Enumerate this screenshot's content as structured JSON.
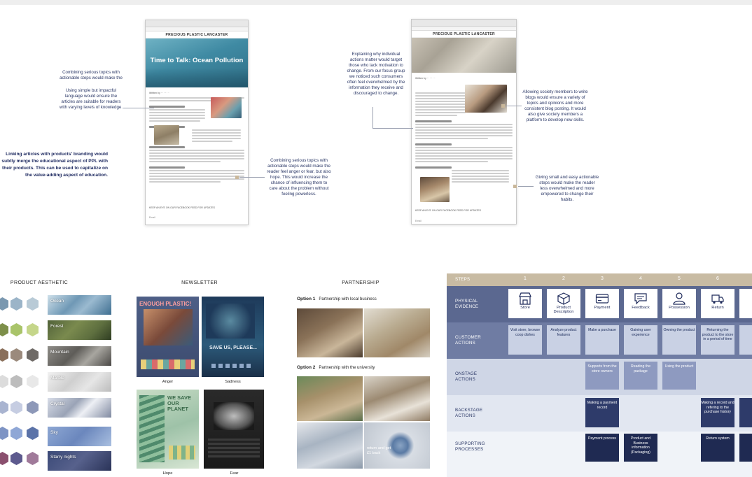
{
  "site": {
    "brand": "PRECIOUS PLASTIC LANCASTER",
    "hero_title": "Time to Talk: Ocean Pollution",
    "footer_text": "KEEP AN EYE ON OUR FACEBOOK FEED FOR UPDATES"
  },
  "annotations": {
    "combining_serious_topics": "Combining serious topics with actionable steps would make the",
    "simple_language": "Using simple but impactful language would ensure the articles are suitable for readers with varying levels of knowledge.",
    "linking_articles": "Linking articles with products' branding would subtly merge the educational aspect of PPL with their products. This can be used to capitalize on the value-adding aspect of education.",
    "hope_and_fear": "Combining serious topics with actionable steps would make the reader feel anger or fear, but also hope. This would increase the chance of influencing them to care about the problem without feeling powerless.",
    "explaining_actions": "Explaining why individual actions matter would target those who lack motivation to change. From our focus group we noticed such consumers often feel overwhelmed by the information they receive and discouraged to change.",
    "society_members": "Allowing society members to write blogs would ensure a variety of topics and opinions and more consistent blog posting. It would also give society members a platform to develop new skills.",
    "small_steps": "Giving small and easy actionable steps would make the reader less overwhelmed and more empowered to change their habits."
  },
  "product_aesthetic": {
    "title": "PRODUCT AESTHETIC",
    "swatches": [
      "Ocean",
      "Forest",
      "Mountain",
      "Marble",
      "Crystal",
      "Sky",
      "Starry nights"
    ]
  },
  "newsletter": {
    "title": "NEWSLETTER",
    "posters": [
      {
        "label": "Anger",
        "headline": "ENOUGH PLASTIC!"
      },
      {
        "label": "Sadness",
        "headline": "SAVE US, PLEASE..."
      },
      {
        "label": "Hope",
        "headline": "WE SAVE OUR PLANET"
      },
      {
        "label": "Fear",
        "headline": ""
      }
    ]
  },
  "partnership": {
    "title": "PARTNERSHIP",
    "option1": {
      "number": "Option 1",
      "text": "Partnership with local business"
    },
    "option2": {
      "number": "Option 2",
      "text": "Partnership with the university"
    },
    "photo_caption": "return and get £1 back"
  },
  "blueprint": {
    "header": "STEPS",
    "steps": [
      "1",
      "2",
      "3",
      "4",
      "5",
      "6"
    ],
    "rows": {
      "physical": "PHYSICAL EVIDENCE",
      "customer": "CUSTOMER ACTIONS",
      "onstage": "ONSTAGE ACTIONS",
      "backstage": "BACKSTAGE ACTIONS",
      "supporting": "SUPPORTING PROCESSES"
    },
    "evidence": [
      {
        "label": "Store",
        "icon": "store-icon"
      },
      {
        "label": "Product Description",
        "icon": "box-icon"
      },
      {
        "label": "Payment",
        "icon": "credit-card-icon"
      },
      {
        "label": "Feedback",
        "icon": "feedback-icon"
      },
      {
        "label": "Possession",
        "icon": "person-icon"
      },
      {
        "label": "Return",
        "icon": "return-truck-icon"
      }
    ],
    "customer_actions": [
      "Visit store, browse coop dishes",
      "Analyze product features",
      "Make a purchase",
      "Gaining user experience",
      "Owning the product",
      "Returning the product to the store in a period of time"
    ],
    "onstage_actions": [
      "",
      "",
      "Supports from the store owners",
      "Reading the package",
      "Using the product",
      ""
    ],
    "backstage_actions": [
      "",
      "",
      "Making a payment record",
      "",
      "",
      "Making a record and refering to the purchase history"
    ],
    "supporting_processes": [
      "",
      "",
      "Payment process",
      "Product and Business information (Packaging)",
      "",
      "Return system"
    ]
  },
  "colors": {
    "navy": "#1f2a52",
    "row_physical": "#5b6890",
    "row_customer": "#6f7ca3",
    "row_onstage": "#cfd6e6",
    "row_backstage": "#e2e7f1",
    "row_supporting": "#f0f3f8",
    "header_tan": "#c8bba3"
  }
}
